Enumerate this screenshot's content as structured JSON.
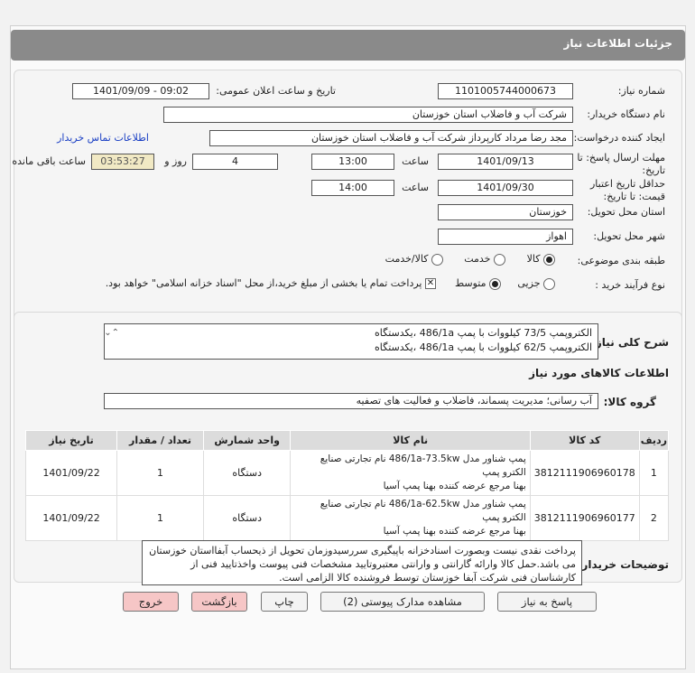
{
  "title": "جزئیات اطلاعات نیاز",
  "labels": {
    "need_number": "شماره نیاز:",
    "announce_datetime": "تاریخ و ساعت اعلان عمومی:",
    "buyer_org": "نام دستگاه خریدار:",
    "requester": "ایجاد کننده درخواست:",
    "reply_deadline": "مهلت ارسال پاسخ: تا تاریخ:",
    "hour": "ساعت",
    "and_days": "روز و",
    "remaining": "ساعت باقی مانده",
    "price_validity": "حداقل تاریخ اعتبار قیمت: تا تاریخ:",
    "delivery_province": "استان محل تحویل:",
    "delivery_city": "شهر محل تحویل:",
    "subject_category": "طبقه بندی موضوعی:",
    "purchase_type": "نوع فرآیند خرید :",
    "general_desc": "شرح کلی نیاز:",
    "goods_info": "اطلاعات کالاهای مورد نیاز",
    "goods_group": "گروه کالا:",
    "buyer_notes": "توضیحات خریدار:"
  },
  "fields": {
    "need_number": "1101005744000673",
    "announce_datetime": "1401/09/09 - 09:02",
    "buyer_org": "شرکت آب و فاضلاب استان خوزستان",
    "requester": "مجد رضا مرداد کارپرداز شرکت آب و فاضلاب استان خوزستان",
    "contact_link": "اطلاعات تماس خریدار",
    "reply_date": "1401/09/13",
    "reply_hour": "13:00",
    "reply_days": "4",
    "reply_remaining": "03:53:27",
    "validity_date": "1401/09/30",
    "validity_hour": "14:00",
    "province": "خوزستان",
    "city": "اهواز",
    "goods_group": "آب رسانی؛ مدیریت پسماند، فاضلاب و فعالیت های تصفیه",
    "general_desc_line1": "الکتروپمپ 73/5 کیلووات با پمپ 486/1a ،یکدستگاه",
    "general_desc_line2": "الکتروپمپ 62/5 کیلووات با پمپ 486/1a ،یکدستگاه",
    "buyer_notes": "پرداخت نقدی نیست وبصورت اسنادخزانه باپیگیری سررسیدوزمان تحویل از ذیحساب آبفااستان خوزستان می باشد.حمل کالا وارائه گارانتی و وارانتی معتبروتایید مشخصات فنی پیوست واخذتایید فنی از کارشناسان فنی شرکت آبفا خوزستان توسط فروشنده کالا الزامی است."
  },
  "category_options": [
    "کالا",
    "خدمت",
    "کالا/خدمت"
  ],
  "category_selected": "کالا",
  "purchase_options": [
    "جزیی",
    "متوسط"
  ],
  "purchase_selected": "متوسط",
  "treasury_note": "پرداخت تمام یا بخشی از مبلغ خرید،از محل \"اسناد خزانه اسلامی\" خواهد بود.",
  "table": {
    "headers": [
      "ردیف",
      "کد کالا",
      "نام کالا",
      "واحد شمارش",
      "تعداد / مقدار",
      "تاریخ نیاز"
    ],
    "rows": [
      {
        "row": "1",
        "code": "3812111906960178",
        "name_line1": "پمپ شناور مدل 486/1a-73.5kw نام تجارتی صنایع الکترو پمپ",
        "name_line2": "بهنا مرجع عرضه کننده بهنا پمپ آسیا",
        "unit": "دستگاه",
        "qty": "1",
        "date": "1401/09/22"
      },
      {
        "row": "2",
        "code": "3812111906960177",
        "name_line1": "پمپ شناور مدل 486/1a-62.5kw نام تجارتی صنایع الکترو پمپ",
        "name_line2": "بهنا مرجع عرضه کننده بهنا پمپ آسیا",
        "unit": "دستگاه",
        "qty": "1",
        "date": "1401/09/22"
      }
    ]
  },
  "buttons": {
    "reply": "پاسخ به نیاز",
    "attachments": "مشاهده مدارک پیوستی (2)",
    "print": "چاپ",
    "back": "بازگشت",
    "exit": "خروج"
  },
  "colors": {
    "titlebar": "#8a8a8a",
    "link": "#1a3fc4",
    "remaining_bg": "#f1e9c4",
    "danger_button": "#f6c6c6"
  }
}
